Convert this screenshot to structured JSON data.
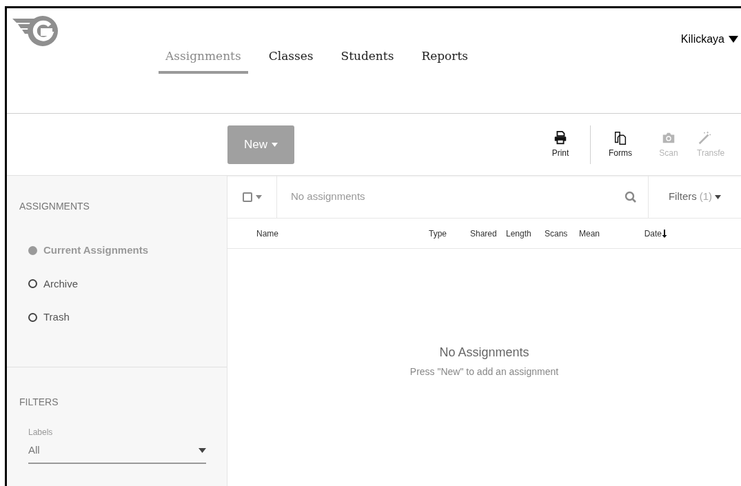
{
  "user": {
    "name": "Kilickaya"
  },
  "nav_tabs": [
    {
      "label": "Assignments",
      "selected": true
    },
    {
      "label": "Classes",
      "selected": false
    },
    {
      "label": "Students",
      "selected": false
    },
    {
      "label": "Reports",
      "selected": false
    }
  ],
  "toolbar": {
    "new_button": "New",
    "tools": [
      {
        "kind": "print",
        "label": "Print",
        "disabled": false
      },
      {
        "kind": "forms",
        "label": "Forms",
        "disabled": false
      },
      {
        "kind": "scan",
        "label": "Scan",
        "disabled": true
      },
      {
        "kind": "transfer",
        "label": "Transfe",
        "disabled": true
      }
    ]
  },
  "sidebar": {
    "heading": "ASSIGNMENTS",
    "items": [
      {
        "label": "Current Assignments",
        "selected": true
      },
      {
        "label": "Archive",
        "selected": false
      },
      {
        "label": "Trash",
        "selected": false
      }
    ],
    "filters_heading": "FILTERS",
    "labels_filter": {
      "label": "Labels",
      "value": "All"
    }
  },
  "list": {
    "select_all": {
      "checked": false
    },
    "search": {
      "placeholder": "No assignments"
    },
    "filters_button": {
      "label": "Filters",
      "count": "(1)"
    },
    "columns": [
      {
        "label": "Name",
        "sorted": false
      },
      {
        "label": "Type",
        "sorted": false
      },
      {
        "label": "Shared",
        "sorted": false
      },
      {
        "label": "Length",
        "sorted": false
      },
      {
        "label": "Scans",
        "sorted": false
      },
      {
        "label": "Mean",
        "sorted": false
      },
      {
        "label": "Date",
        "sorted": true
      }
    ],
    "empty_title": "No Assignments",
    "empty_hint": "Press \"New\" to add an assignment"
  }
}
